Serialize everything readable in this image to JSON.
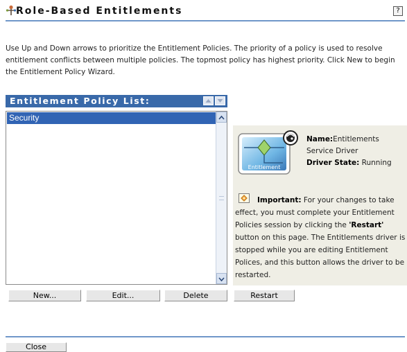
{
  "page": {
    "title": "Role-Based Entitlements",
    "help_glyph": "?",
    "description": "Use Up and Down arrows to prioritize the Entitlement Policies. The priority of a policy is used to resolve entitlement conflicts between multiple policies. The topmost policy has highest priority. Click New to begin the Entitlement Policy Wizard."
  },
  "policy_list": {
    "header": "Entitlement Policy List:",
    "items": [
      "Security"
    ]
  },
  "list_buttons": {
    "new": "New...",
    "edit": "Edit...",
    "delete": "Delete"
  },
  "driver": {
    "image_caption": "Entitlement",
    "name_label": "Name:",
    "name_first": "Entitlements",
    "name_rest": "Service Driver",
    "state_label": "Driver State:",
    "state_value": " Running"
  },
  "important": {
    "label": "Important:",
    "text_before": " For your changes to take effect, you must complete your Entitlement Policies session by clicking the ",
    "restart_quote": "'Restart'",
    "text_after": " button on this page. The Entitlements driver is stopped while you are editing Entitlement Polices, and this button allows the driver to be restarted."
  },
  "restart_button": "Restart",
  "close_button": "Close",
  "colors": {
    "header_blue": "#3969a9",
    "selection_blue": "#3164b4",
    "rule_blue": "#6f97c9",
    "info_panel_bg": "#efeee5"
  },
  "icons": {
    "title": "entitlement-role-icon",
    "help": "help-icon",
    "move_up": "arrow-up-icon",
    "move_down": "arrow-down-icon",
    "driver": "entitlement-driver-icon",
    "important": "important-notice-icon"
  }
}
